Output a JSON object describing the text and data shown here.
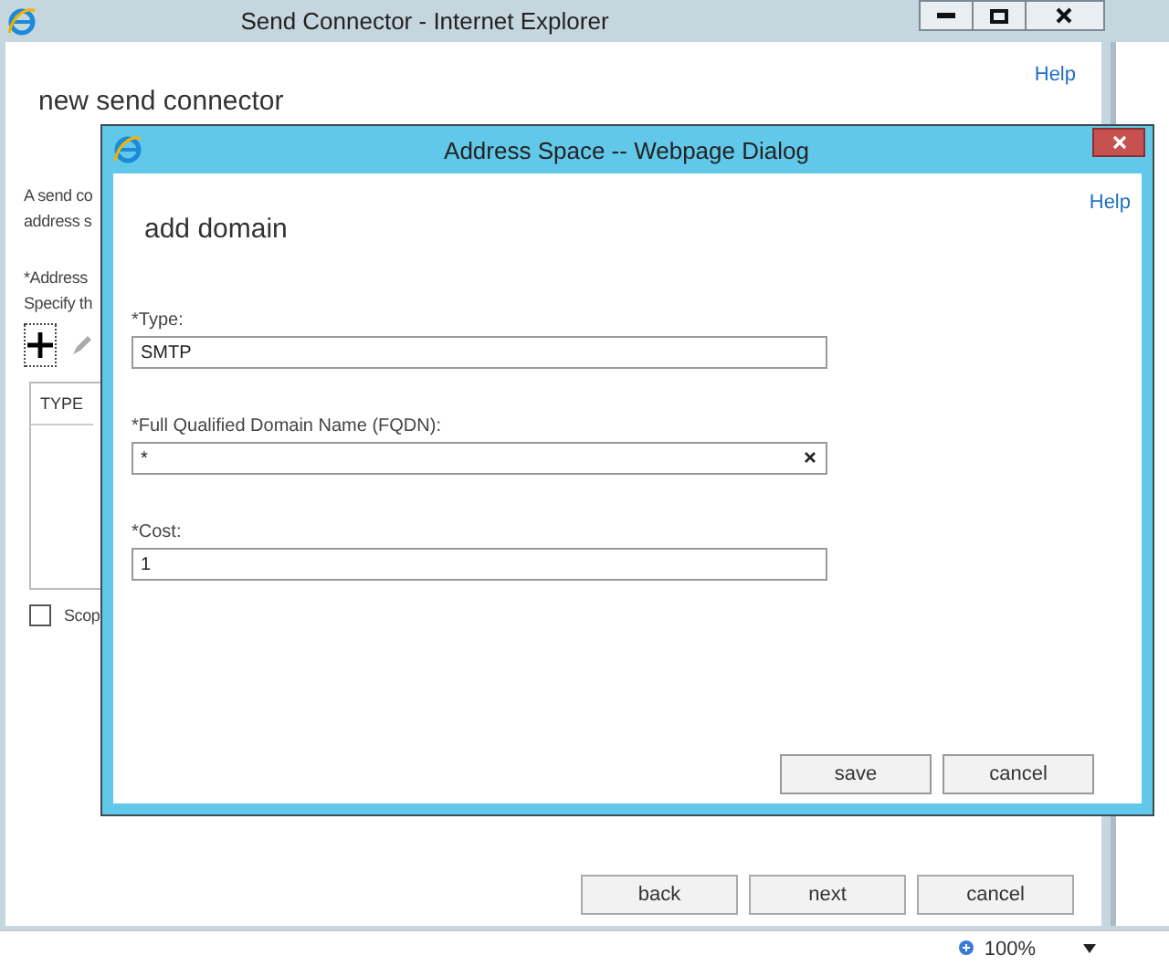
{
  "window": {
    "title": "Send Connector - Internet Explorer"
  },
  "page": {
    "help_link": "Help",
    "heading": "new send connector",
    "description_lines": [
      "A send co",
      "address s"
    ],
    "address_label": "*Address",
    "address_hint": "Specify th",
    "table": {
      "columns": [
        "TYPE"
      ]
    },
    "scope_checkbox": {
      "label": "Scop",
      "checked": false
    }
  },
  "buttons": [
    "back",
    "next",
    "cancel"
  ],
  "status_bar": {
    "zoom": "100%"
  },
  "dialog": {
    "title": "Address Space -- Webpage Dialog",
    "help_link": "Help",
    "heading": "add domain",
    "fields": [
      {
        "label": "*Type:",
        "value": "SMTP",
        "clearable": false
      },
      {
        "label": "*Full Qualified Domain Name (FQDN):",
        "value": "*",
        "clearable": true
      },
      {
        "label": "*Cost:",
        "value": "1",
        "clearable": false
      }
    ],
    "buttons": [
      "save",
      "cancel"
    ]
  }
}
